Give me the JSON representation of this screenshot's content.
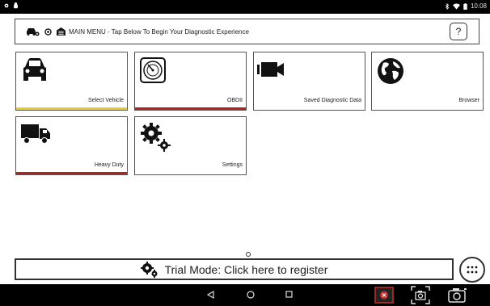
{
  "status_bar": {
    "time": "10:08",
    "left_icons": [
      "gear-notification-icon",
      "android-notification-icon"
    ],
    "right_icons": [
      "bluetooth-icon",
      "wifi-icon",
      "battery-icon"
    ]
  },
  "header": {
    "title": "MAIN MENU - Tap Below To Begin Your Diagnostic Experience",
    "help_label": "?"
  },
  "tiles": [
    {
      "label": "Select Vehicle",
      "icon": "car-icon",
      "bar_color": "#e6cf2f"
    },
    {
      "label": "OBDII",
      "icon": "gauge-icon",
      "bar_color": "#b32121"
    },
    {
      "label": "Saved Diagnostic Data",
      "icon": "video-camera-icon",
      "bar_color": ""
    },
    {
      "label": "Browser",
      "icon": "globe-icon",
      "bar_color": ""
    },
    {
      "label": "Heavy Duty",
      "icon": "truck-icon",
      "bar_color": "#b32121"
    },
    {
      "label": "Settings",
      "icon": "gears-icon",
      "bar_color": ""
    }
  ],
  "trial": {
    "text": "Trial Mode: Click here to register"
  },
  "nav_bar": {
    "icons": [
      "back-icon",
      "home-icon",
      "recents-icon",
      "screen-record-icon",
      "screenshot-icon",
      "camera-icon"
    ]
  },
  "colors": {
    "status_bg": "#000000",
    "red_bar": "#b32121",
    "yellow_bar": "#e6cf2f"
  }
}
